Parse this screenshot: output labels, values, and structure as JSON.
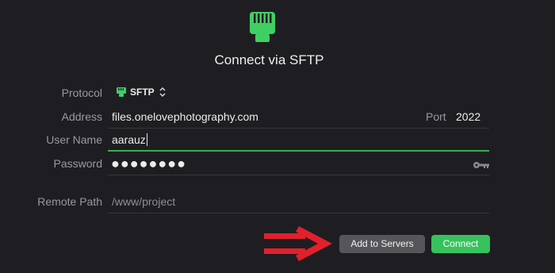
{
  "dialog": {
    "title": "Connect via SFTP"
  },
  "form": {
    "protocol": {
      "label": "Protocol",
      "value": "SFTP"
    },
    "address": {
      "label": "Address",
      "value": "files.onelovephotography.com"
    },
    "port": {
      "label": "Port",
      "value": "2022"
    },
    "username": {
      "label": "User Name",
      "value": "aarauz"
    },
    "password": {
      "label": "Password",
      "value": "●●●●●●●●"
    },
    "remote_path": {
      "label": "Remote Path",
      "placeholder": "/www/project"
    }
  },
  "buttons": {
    "add_to_servers": "Add to Servers",
    "connect": "Connect"
  },
  "icons": {
    "header": "ethernet-icon",
    "protocol": "ethernet-icon",
    "protocol_toggle": "chevron-up-down-icon",
    "password_toggle": "key-icon",
    "annotation": "red-arrow-icon"
  },
  "colors": {
    "background": "#1e1e22",
    "accent_green": "#37c25e",
    "focus_line": "#3cab4f",
    "annotation_red": "#e2202c"
  }
}
